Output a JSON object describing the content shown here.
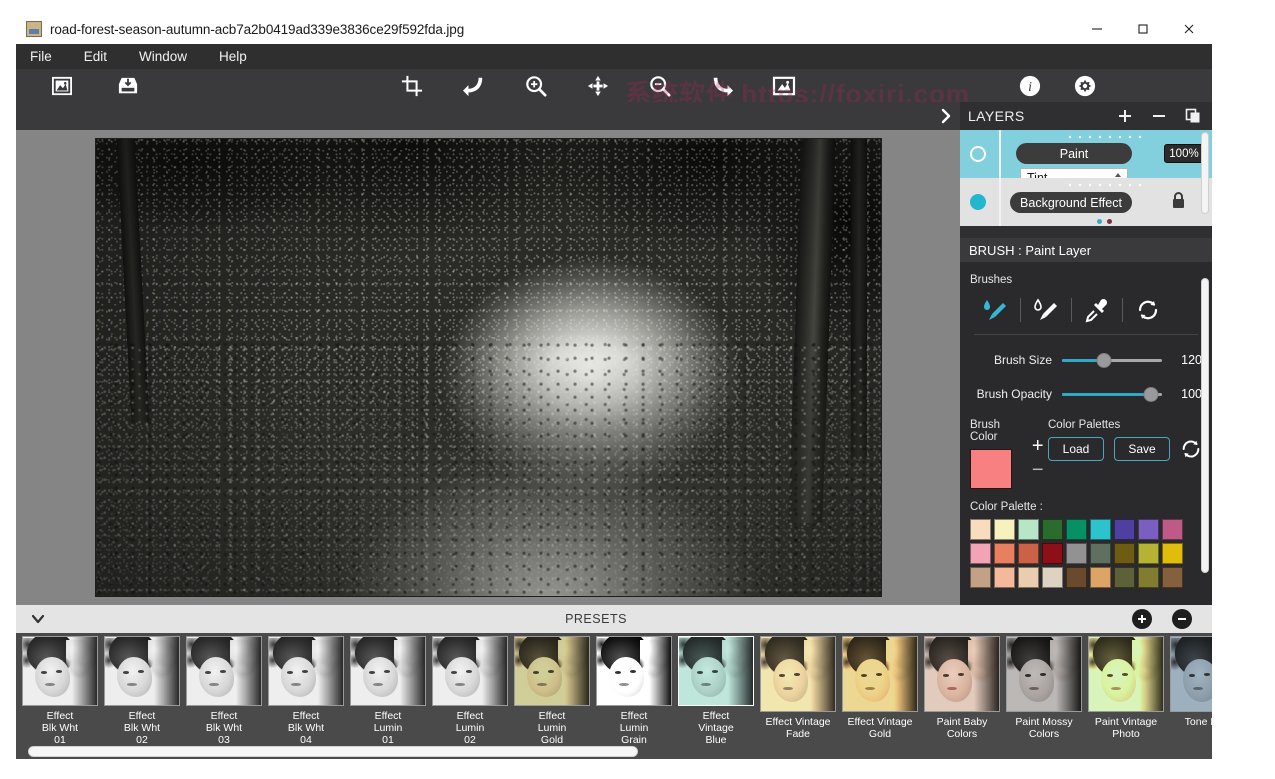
{
  "window": {
    "title": "road-forest-season-autumn-acb7a2b0419ad339e3836ce29f592fda.jpg",
    "minimize": "–",
    "maximize": "□",
    "close": "✕"
  },
  "menubar": {
    "items": [
      {
        "label": "File"
      },
      {
        "label": "Edit"
      },
      {
        "label": "Window"
      },
      {
        "label": "Help"
      }
    ]
  },
  "toolbar": {
    "buttons": [
      {
        "name": "open-image-icon",
        "tip": "Open Image"
      },
      {
        "name": "save-image-icon",
        "tip": "Save Image"
      },
      {
        "name": "crop-icon",
        "tip": "Crop"
      },
      {
        "name": "undo-icon",
        "tip": "Undo"
      },
      {
        "name": "zoom-in-icon",
        "tip": "Zoom In"
      },
      {
        "name": "move-icon",
        "tip": "Move"
      },
      {
        "name": "zoom-out-icon",
        "tip": "Zoom Out"
      },
      {
        "name": "redo-icon",
        "tip": "Redo"
      },
      {
        "name": "fit-image-icon",
        "tip": "Fit Image"
      },
      {
        "name": "info-icon",
        "tip": "Info"
      },
      {
        "name": "settings-icon",
        "tip": "Settings"
      }
    ]
  },
  "watermarks": [
    "https://foxiri.com",
    "系统软件",
    "系统软件 https://foxiri.com",
    "系统软件 foxiri.com"
  ],
  "layers": {
    "title": "LAYERS",
    "add_label": "+",
    "remove_label": "−",
    "duplicate_name": "duplicate-layer-icon",
    "items": [
      {
        "name": "Paint",
        "opacity": "100%",
        "blend_mode": "Tint",
        "selected": true,
        "visible": false,
        "locked": false
      },
      {
        "name": "Background Effect",
        "opacity": "",
        "blend_mode": "",
        "selected": false,
        "visible": true,
        "locked": true
      }
    ]
  },
  "brush": {
    "header": "BRUSH : Paint Layer",
    "brushes_label": "Brushes",
    "tools": [
      {
        "name": "paint-brush-icon",
        "active": true
      },
      {
        "name": "smudge-brush-icon",
        "active": false
      },
      {
        "name": "eyedropper-icon",
        "active": false
      },
      {
        "name": "reset-brush-icon",
        "active": false
      }
    ],
    "size_label": "Brush Size",
    "size_value": "120",
    "size_percent": 42,
    "opacity_label": "Brush Opacity",
    "opacity_value": "100",
    "opacity_percent": 89,
    "brush_color_label": "Brush Color",
    "brush_color_hex": "#f98080",
    "add_color_label": "+",
    "remove_color_label": "−",
    "color_palettes_label": "Color Palettes",
    "load_label": "Load",
    "save_label": "Save",
    "reset_palette_name": "reset-palette-icon",
    "palette_label": "Color Palette :",
    "palette_colors": [
      "#f7ddbe",
      "#f7f1bd",
      "#b6e6c6",
      "#2b6b2e",
      "#089065",
      "#2cc3cc",
      "#4f3fa0",
      "#7a5fc0",
      "#bd5a88",
      "#f2a3b6",
      "#e87f5f",
      "#cb6246",
      "#8d0f18",
      "#929292",
      "#5f7060",
      "#6e5c14",
      "#b5b234",
      "#e1bc0b",
      "#c2a184",
      "#f3b99a",
      "#e9cdae",
      "#ded3c0",
      "#6b492c",
      "#dda465",
      "#5c6137",
      "#827c31",
      "#84603c"
    ]
  },
  "presets": {
    "bar_title": "PRESETS",
    "collapse_name": "chevron-down-icon",
    "add_name": "add-preset-icon",
    "remove_name": "remove-preset-icon",
    "items": [
      {
        "label": "Effect\nBlk Wht\n01",
        "tone": "none",
        "selected": false
      },
      {
        "label": "Effect\nBlk Wht\n02",
        "tone": "none",
        "selected": false
      },
      {
        "label": "Effect\nBlk Wht\n03",
        "tone": "none",
        "selected": false
      },
      {
        "label": "Effect\nBlk Wht\n04",
        "tone": "none",
        "selected": false
      },
      {
        "label": "Effect\nLumin\n01",
        "tone": "none",
        "selected": false
      },
      {
        "label": "Effect\nLumin\n02",
        "tone": "none",
        "selected": false
      },
      {
        "label": "Effect\nLumin\nGold",
        "tone": "olive",
        "selected": false
      },
      {
        "label": "Effect\nLumin\nGrain",
        "tone": "grain",
        "selected": false
      },
      {
        "label": "Effect\nVintage\nBlue",
        "tone": "mint",
        "selected": true
      },
      {
        "label": "Effect Vintage\nFade",
        "tone": "sepia",
        "selected": false
      },
      {
        "label": "Effect Vintage\nGold",
        "tone": "gold",
        "selected": false
      },
      {
        "label": "Paint Baby\nColors",
        "tone": "baby",
        "selected": false
      },
      {
        "label": "Paint Mossy\nColors",
        "tone": "mossy",
        "selected": false
      },
      {
        "label": "Paint Vintage\nPhoto",
        "tone": "vintage",
        "selected": false
      },
      {
        "label": "Tone Blue",
        "tone": "blue",
        "selected": false
      }
    ]
  },
  "canvas": {
    "expand_name": "chevron-right-icon",
    "image_alt": "road-forest-season-autumn black and white photo"
  }
}
